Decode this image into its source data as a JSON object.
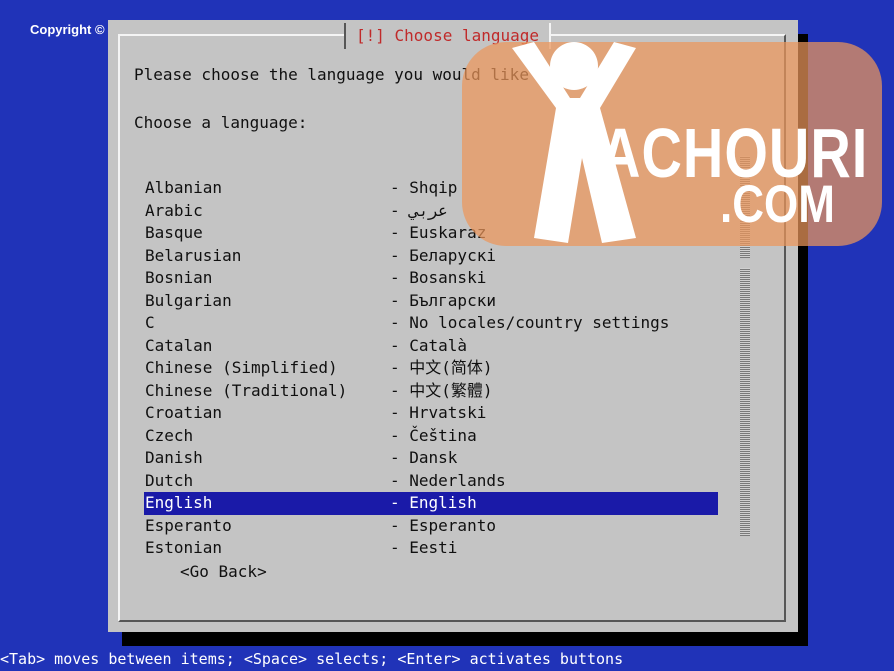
{
  "copyright": "Copyright © Kachouri.com",
  "dialog": {
    "title": "[!] Choose language",
    "prompt": "Please choose the language you would like to use.",
    "subprompt": "Choose a language:",
    "languages": [
      {
        "name": "Albanian",
        "native": "- Shqip"
      },
      {
        "name": "Arabic",
        "native": "- عربي"
      },
      {
        "name": "Basque",
        "native": "- Euskaraz"
      },
      {
        "name": "Belarusian",
        "native": "- Беларускі"
      },
      {
        "name": "Bosnian",
        "native": "- Bosanski"
      },
      {
        "name": "Bulgarian",
        "native": "- Български"
      },
      {
        "name": "C",
        "native": "- No locales/country settings"
      },
      {
        "name": "Catalan",
        "native": "- Català"
      },
      {
        "name": "Chinese (Simplified)",
        "native": "- 中文(简体)"
      },
      {
        "name": "Chinese (Traditional)",
        "native": "- 中文(繁體)"
      },
      {
        "name": "Croatian",
        "native": "- Hrvatski"
      },
      {
        "name": "Czech",
        "native": "- Čeština"
      },
      {
        "name": "Danish",
        "native": "- Dansk"
      },
      {
        "name": "Dutch",
        "native": "- Nederlands"
      },
      {
        "name": "English",
        "native": "- English"
      },
      {
        "name": "Esperanto",
        "native": "- Esperanto"
      },
      {
        "name": "Estonian",
        "native": "- Eesti"
      }
    ],
    "selected_index": 14,
    "go_back": "<Go Back>"
  },
  "hint": "<Tab> moves between items; <Space> selects; <Enter> activates buttons",
  "watermark": {
    "line1": "ACHOURI",
    "line2": ".COM"
  },
  "colors": {
    "background": "#2033b8",
    "dialog": "#c4c4c4",
    "selection": "#1a1aa8",
    "title_text": "#c02a2a",
    "watermark": "#ec965a"
  }
}
